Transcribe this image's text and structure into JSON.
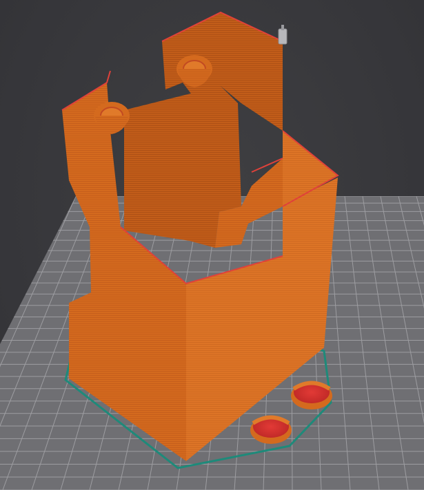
{
  "viewport": {
    "background": "#3a3a3c",
    "bed_fill": "#6f6f73",
    "bed_grid": "#a6a6aa",
    "model_color": "#d46a1e",
    "model_dark": "#b8541a",
    "model_light": "#e07a2a",
    "perimeter_color": "#e0413a",
    "skirt_color": "#1e8a7a",
    "icons": [
      "sliced-model-icon",
      "skirt-outline-icon",
      "print-bed-grid-icon",
      "nozzle-marker-icon"
    ]
  }
}
